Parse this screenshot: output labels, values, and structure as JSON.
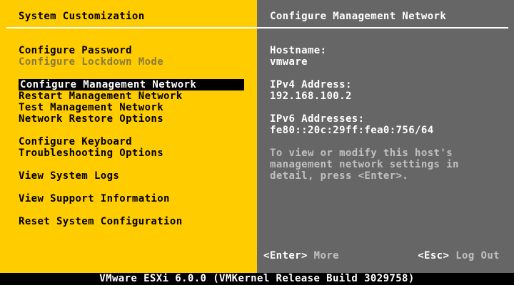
{
  "left_panel": {
    "title": "System Customization",
    "menu": [
      {
        "label": "Configure Password",
        "state": "normal"
      },
      {
        "label": "Configure Lockdown Mode",
        "state": "disabled"
      },
      {
        "label": "Configure Management Network",
        "state": "selected"
      },
      {
        "label": "Restart Management Network",
        "state": "normal"
      },
      {
        "label": "Test Management Network",
        "state": "normal"
      },
      {
        "label": "Network Restore Options",
        "state": "normal"
      },
      {
        "label": "Configure Keyboard",
        "state": "normal"
      },
      {
        "label": "Troubleshooting Options",
        "state": "normal"
      },
      {
        "label": "View System Logs",
        "state": "normal"
      },
      {
        "label": "View Support Information",
        "state": "normal"
      },
      {
        "label": "Reset System Configuration",
        "state": "normal"
      }
    ]
  },
  "right_panel": {
    "title": "Configure Management Network",
    "hostname_label": "Hostname:",
    "hostname_value": "vmware",
    "ipv4_label": "IPv4 Address:",
    "ipv4_value": "192.168.100.2",
    "ipv6_label": "IPv6 Addresses:",
    "ipv6_value": "fe80::20c:29ff:fea0:756/64",
    "description": [
      "To view or modify this host's",
      "management network settings in",
      "detail, press <Enter>."
    ]
  },
  "footer": {
    "enter_key": "<Enter>",
    "enter_action": "More",
    "esc_key": "<Esc>",
    "esc_action": "Log Out"
  },
  "status_bar": {
    "text": "VMware ESXi 6.0.0 (VMKernel Release Build 3029758)"
  },
  "colors": {
    "left_background": "#FFCC00",
    "right_background": "#666666",
    "selection_background": "#000000",
    "disabled_text": "#8A7A3A"
  }
}
